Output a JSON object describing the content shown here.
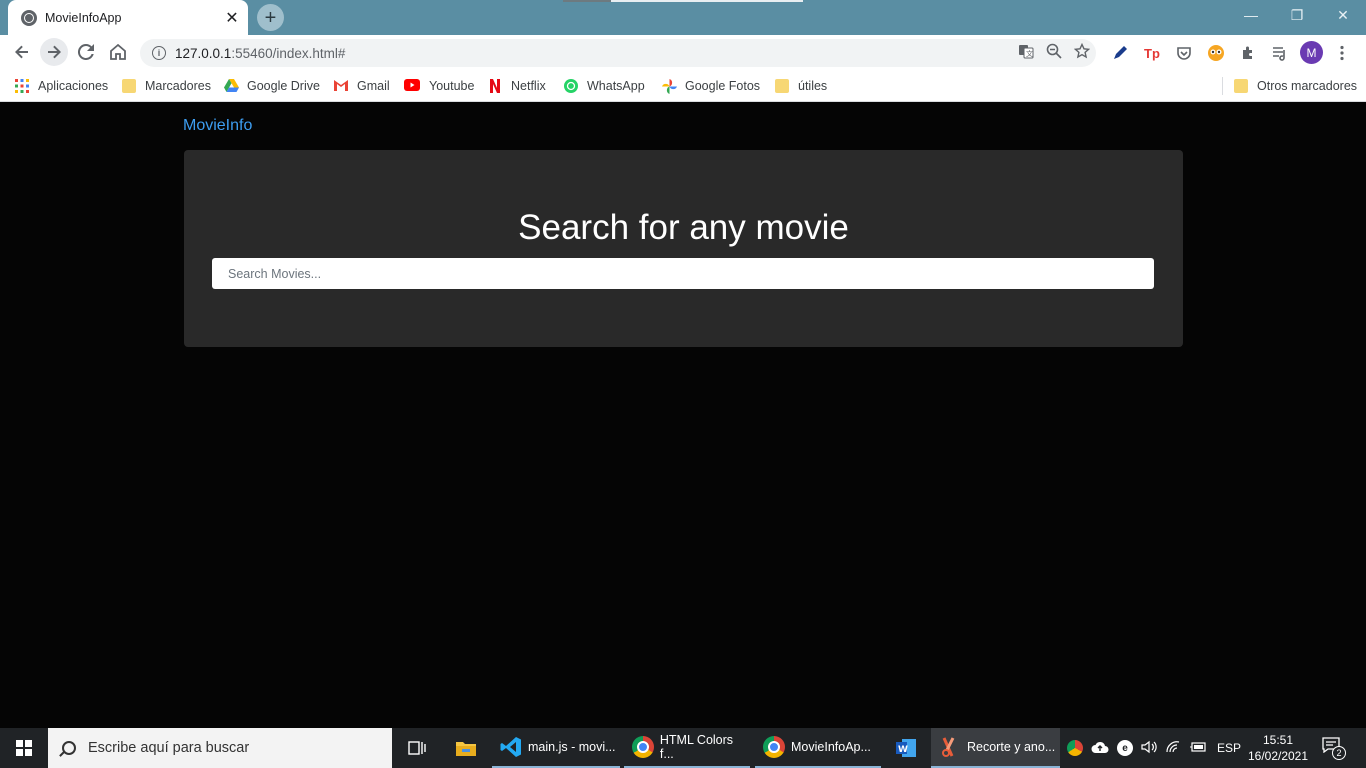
{
  "browser": {
    "tab": {
      "title": "MovieInfoApp",
      "close": "✕"
    },
    "newtab": "+",
    "window_controls": {
      "minimize": "—",
      "restore": "❐",
      "close": "✕"
    },
    "url": {
      "host": "127.0.0.1",
      "path": ":55460/index.html#"
    },
    "profile_initial": "M",
    "bookmarks": [
      {
        "label": "Aplicaciones",
        "icon": "apps-grid-icon"
      },
      {
        "label": "Marcadores",
        "icon": "folder-icon"
      },
      {
        "label": "Google Drive",
        "icon": "google-drive-icon"
      },
      {
        "label": "Gmail",
        "icon": "gmail-icon"
      },
      {
        "label": "Youtube",
        "icon": "youtube-icon"
      },
      {
        "label": "Netflix",
        "icon": "netflix-icon"
      },
      {
        "label": "WhatsApp",
        "icon": "whatsapp-icon"
      },
      {
        "label": "Google Fotos",
        "icon": "google-photos-icon"
      },
      {
        "label": "útiles",
        "icon": "folder-icon"
      }
    ],
    "other_bookmarks": "Otros marcadores"
  },
  "page": {
    "brand": "MovieInfo",
    "heading": "Search for any movie",
    "search": {
      "placeholder": "Search Movies..."
    },
    "colors": {
      "brand": "#3d9df0",
      "jumbotron": "#292929",
      "background": "#050505"
    }
  },
  "taskbar": {
    "search_placeholder": "Escribe aquí para buscar",
    "apps": [
      {
        "label": "main.js - movi...",
        "icon": "vscode-icon"
      },
      {
        "label": "HTML Colors f...",
        "icon": "chrome-icon"
      },
      {
        "label": "MovieInfoAp...",
        "icon": "chrome-icon"
      },
      {
        "label": "Recorte y ano...",
        "icon": "snip-sketch-icon"
      }
    ],
    "language": "ESP",
    "time": "15:51",
    "date": "16/02/2021",
    "notifications": "2"
  }
}
